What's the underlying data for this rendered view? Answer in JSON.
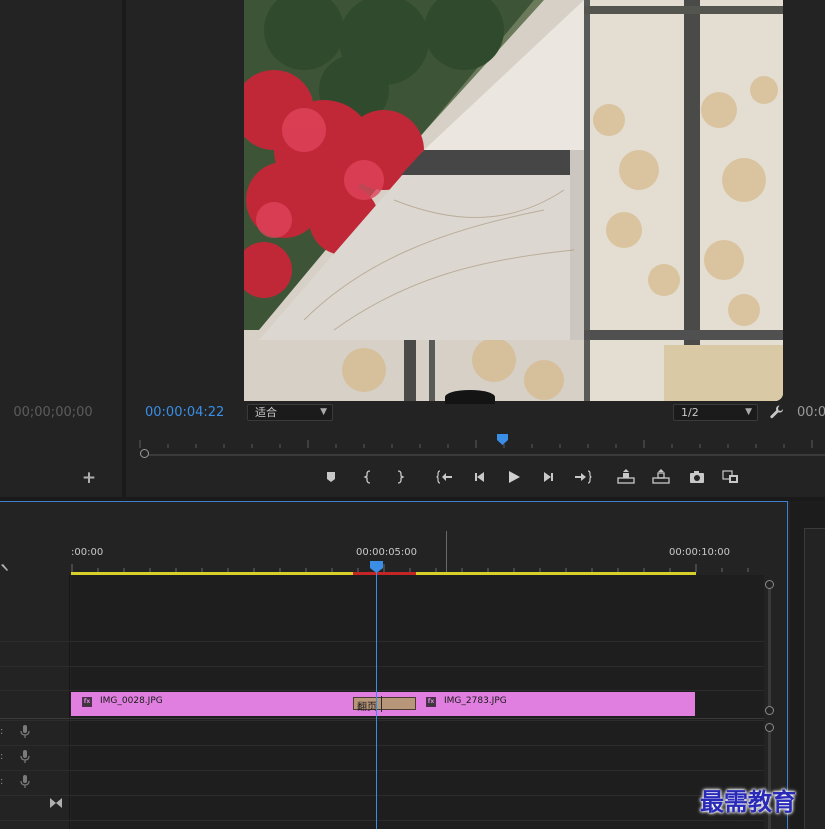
{
  "source_monitor": {
    "timecode": "00;00;00;00",
    "add_button": "+"
  },
  "program_monitor": {
    "timecode": "00:00:04:22",
    "fit_dropdown": {
      "selected": "适合"
    },
    "resolution_dropdown": {
      "selected": "1/2"
    },
    "duration_timecode": "00:0",
    "icons": [
      "wrench-icon"
    ],
    "transport_buttons": [
      {
        "name": "add-marker-button",
        "icon": "marker-icon"
      },
      {
        "name": "mark-in-button",
        "icon": "mark-in-icon"
      },
      {
        "name": "mark-out-button",
        "icon": "mark-out-icon"
      },
      {
        "name": "go-to-in-button",
        "icon": "go-to-in-icon"
      },
      {
        "name": "step-back-button",
        "icon": "step-back-icon"
      },
      {
        "name": "play-button",
        "icon": "play-icon"
      },
      {
        "name": "step-forward-button",
        "icon": "step-forward-icon"
      },
      {
        "name": "go-to-out-button",
        "icon": "go-to-out-icon"
      },
      {
        "name": "lift-button",
        "icon": "lift-icon"
      },
      {
        "name": "extract-button",
        "icon": "extract-icon"
      },
      {
        "name": "export-frame-button",
        "icon": "camera-icon"
      },
      {
        "name": "compare-view-button",
        "icon": "compare-icon"
      }
    ]
  },
  "timeline": {
    "ruler_labels": [
      ":00:00",
      "00:00:05:00",
      "00:00:10:00"
    ],
    "clips": [
      {
        "name": "IMG_0028.JPG",
        "fx": "fx"
      },
      {
        "name": "IMG_2783.JPG",
        "fx": "fx"
      }
    ],
    "transition": {
      "label": "翻页"
    },
    "colors": {
      "clip": "#e07fdf",
      "work_area": "#d8d02a",
      "render_bar": "#c42525",
      "playhead": "#3a8ee6",
      "transition": "#b8967a"
    }
  },
  "watermark": "最需教育"
}
